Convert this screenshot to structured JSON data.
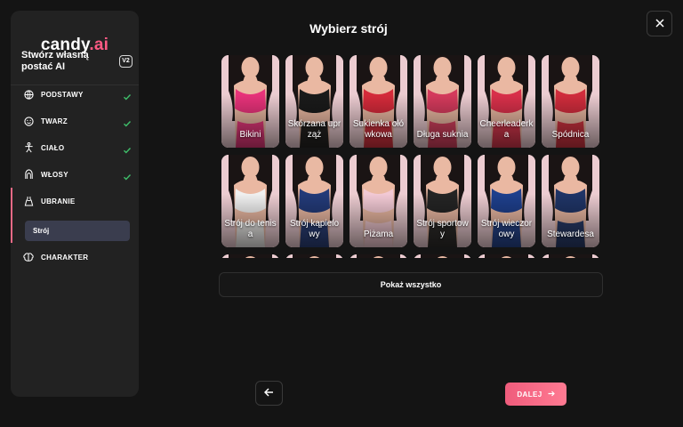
{
  "sidebar": {
    "logo_main": "candy",
    "logo_dot": ".",
    "logo_ai": "ai",
    "create_title": "Stwórz własną postać AI",
    "version_badge": "V2",
    "steps": [
      {
        "label": "PODSTAWY",
        "icon": "globe-icon",
        "done": true
      },
      {
        "label": "TWARZ",
        "icon": "smile-icon",
        "done": true
      },
      {
        "label": "CIAŁO",
        "icon": "body-icon",
        "done": true
      },
      {
        "label": "WŁOSY",
        "icon": "hair-icon",
        "done": true
      },
      {
        "label": "UBRANIE",
        "icon": "dress-icon",
        "done": false,
        "active": true
      },
      {
        "label": "CHARAKTER",
        "icon": "brain-icon",
        "done": false
      }
    ],
    "substep_label": "Strój"
  },
  "main": {
    "title": "Wybierz strój",
    "outfits": [
      {
        "label": "Bikini",
        "color": "#e8327a"
      },
      {
        "label": "Skórzana uprząż",
        "color": "#1a1a1a"
      },
      {
        "label": "Sukienka ołówkowa",
        "color": "#d42a3a"
      },
      {
        "label": "Długa suknia",
        "color": "#d43a5c"
      },
      {
        "label": "Cheerleaderka",
        "color": "#d8304a"
      },
      {
        "label": "Spódnica",
        "color": "#d02c3c"
      },
      {
        "label": "Strój do tenisa",
        "color": "#f0f0f0"
      },
      {
        "label": "Strój kąpielowy",
        "color": "#233a78"
      },
      {
        "label": "Piżama",
        "color": "#f2c9d4"
      },
      {
        "label": "Strój sportowy",
        "color": "#242424"
      },
      {
        "label": "Strój wieczorowy",
        "color": "#1e3f8c"
      },
      {
        "label": "Stewardesa",
        "color": "#1f3466"
      }
    ],
    "show_all": "Pokaż wszystko",
    "next_label": "DALEJ"
  },
  "colors": {
    "accent": "#ff5a84",
    "background": "#141414",
    "sidebar": "#222222",
    "check": "#3fbf6a"
  }
}
